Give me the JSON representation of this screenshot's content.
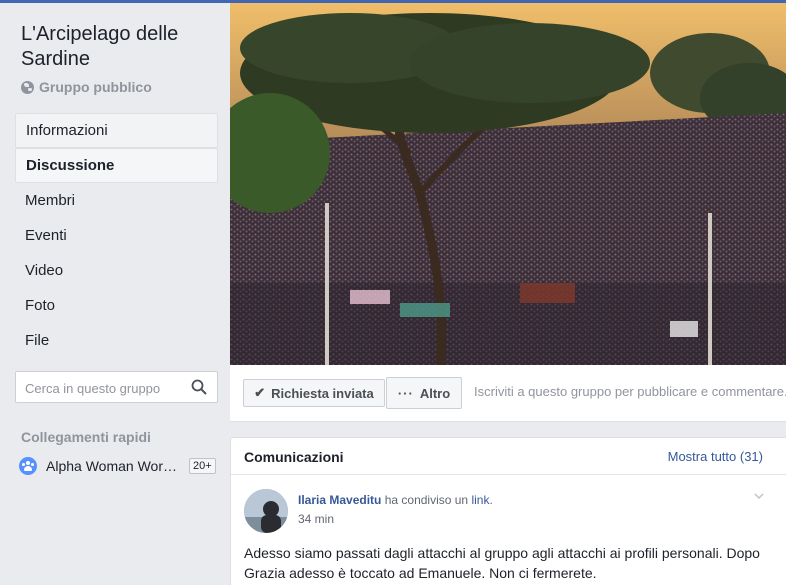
{
  "group": {
    "name": "L'Arcipelago delle Sardine",
    "privacy": "Gruppo pubblico"
  },
  "nav": [
    {
      "label": "Informazioni"
    },
    {
      "label": "Discussione"
    },
    {
      "label": "Membri"
    },
    {
      "label": "Eventi"
    },
    {
      "label": "Video"
    },
    {
      "label": "Foto"
    },
    {
      "label": "File"
    }
  ],
  "search": {
    "placeholder": "Cerca in questo gruppo"
  },
  "quick_links": {
    "title": "Collegamenti rapidi",
    "items": [
      {
        "label": "Alpha Woman Wor…",
        "badge": "20+"
      }
    ]
  },
  "actions": {
    "request_label": "Richiesta inviata",
    "more_label": "Altro",
    "join_hint": "Iscriviti a questo gruppo per pubblicare e commentare."
  },
  "announcements": {
    "title": "Comunicazioni",
    "see_all": "Mostra tutto (31)",
    "post": {
      "author": "Ilaria Maveditu",
      "action": "ha condiviso un",
      "object": "link",
      "time": "34 min",
      "text": "Adesso siamo passati dagli attacchi al gruppo agli attacchi ai profili personali. Dopo Grazia adesso è toccato ad Emanuele. Non ci fermerete."
    }
  },
  "colors": {
    "brand": "#4267b2",
    "link": "#365899",
    "background": "#e9ebee"
  }
}
